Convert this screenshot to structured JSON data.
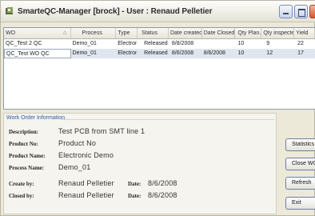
{
  "window": {
    "title": "SmarteQC-Manager  [brock] - User : Renaud Pelletier"
  },
  "grid": {
    "columns": [
      "WO",
      "Process",
      "Type",
      "Status",
      "Date created",
      "Date Closed",
      "Qty Plan...",
      "Qty inspected",
      "Yield"
    ],
    "rows": [
      [
        "QC_Test 2 QC",
        "Demo_01",
        "Electronic",
        "Released",
        "8/8/2008",
        "",
        "10",
        "9",
        "22"
      ],
      [
        "QC_Test WO QC",
        "Demo_01",
        "Electronic",
        "Released",
        "8/6/2008",
        "8/6/2008",
        "10",
        "12",
        "17"
      ]
    ]
  },
  "info": {
    "title": "Work Order Information",
    "description_label": "Description:",
    "description_value": "Test PCB from SMT line 1",
    "product_no_label": "Product No:",
    "product_no_value": "Product No",
    "product_name_label": "Product Name:",
    "product_name_value": "Electronic Demo",
    "process_name_label": "Process Name:",
    "process_name_value": "Demo_01",
    "created_by_label": "Create by:",
    "created_by_value": "Renaud Pelletier",
    "created_date_label": "Date:",
    "created_date_value": "8/6/2008",
    "closed_by_label": "Closed by:",
    "closed_by_value": "Renaud Pelletier",
    "closed_date_label": "Date:",
    "closed_date_value": "8/6/2008"
  },
  "buttons": {
    "statistics": "Statistics",
    "close_wo": "Close WO",
    "refresh": "Refresh",
    "exit": "Exit"
  },
  "icons": {
    "app": "app-logo-icon",
    "minimize": "minimize-icon",
    "maximize": "maximize-icon",
    "close": "close-icon",
    "sort": "sort-arrow-icon"
  },
  "colors": {
    "window_bg": "#ece9d8",
    "selected_row": "#dfe6ef",
    "section_title": "#2a5aa8"
  }
}
